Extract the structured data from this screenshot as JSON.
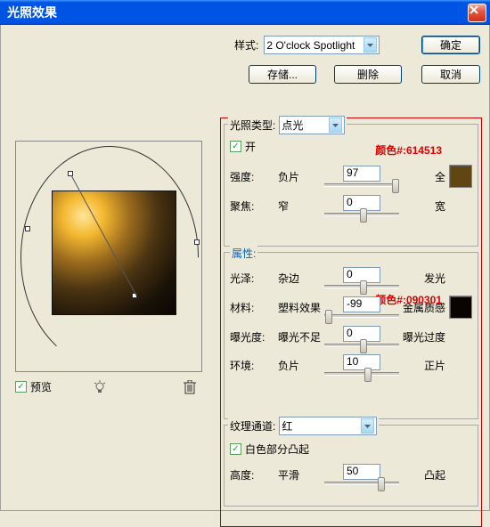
{
  "title": "光照效果",
  "top": {
    "style_label": "样式:",
    "style_value": "2 O'clock Spotlight",
    "store": "存储...",
    "delete": "删除",
    "ok": "确定",
    "cancel": "取消"
  },
  "preview": {
    "label": "预览"
  },
  "light": {
    "legend": "光照类型:",
    "type_value": "点光",
    "on_label": "开",
    "annot1_label": "颜色#:",
    "annot1_value": "614513",
    "intensity": {
      "label": "强度:",
      "left": "负片",
      "right": "全",
      "value": "97"
    },
    "focus": {
      "label": "聚焦:",
      "left": "窄",
      "right": "宽",
      "value": "0"
    },
    "swatch1": "#614513"
  },
  "props": {
    "legend": "属性:",
    "gloss": {
      "label": "光泽:",
      "left": "杂边",
      "right": "发光",
      "value": "0"
    },
    "annot2_label": "颜色#:",
    "annot2_value": "090301",
    "material": {
      "label": "材料:",
      "left": "塑料效果",
      "right": "金属质感",
      "value": "-99"
    },
    "exposure": {
      "label": "曝光度:",
      "left": "曝光不足",
      "right": "曝光过度",
      "value": "0"
    },
    "ambience": {
      "label": "环境:",
      "left": "负片",
      "right": "正片",
      "value": "10"
    },
    "swatch2": "#090301"
  },
  "texture": {
    "legend": "纹理通道:",
    "value": "红",
    "white_high": "白色部分凸起",
    "height": {
      "label": "高度:",
      "left": "平滑",
      "right": "凸起",
      "value": "50"
    }
  }
}
